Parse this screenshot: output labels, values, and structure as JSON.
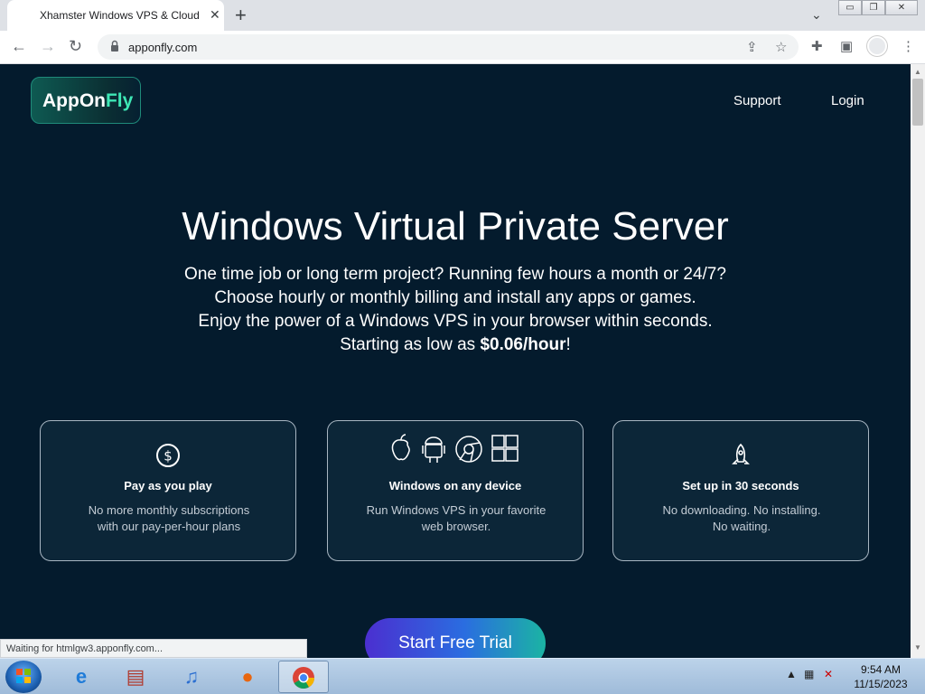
{
  "browser": {
    "tab_title": "Xhamster Windows VPS & Cloud",
    "tab_close": "✕",
    "new_tab": "+",
    "tab_list": "⌄",
    "url": "apponfly.com",
    "status": "Waiting for htmlgw3.apponfly.com..."
  },
  "window_controls": {
    "minimize": "▭",
    "restore": "❐",
    "close": "✕"
  },
  "page": {
    "logo_main": "AppOn",
    "logo_accent": "Fly",
    "nav": {
      "support": "Support",
      "login": "Login"
    },
    "headline": "Windows Virtual Private Server",
    "sub_lines": [
      "One time job or long term project? Running few hours a month or 24/7?",
      "Choose hourly or monthly billing and install any apps or games.",
      "Enjoy the power of a Windows VPS in your browser within seconds."
    ],
    "price_prefix": "Starting as low as ",
    "price": "$0.06/hour",
    "price_suffix": "!",
    "cards": [
      {
        "icon": "dollar-circle-icon",
        "title": "Pay as you play",
        "desc_1": "No more monthly subscriptions",
        "desc_2": "with our pay-per-hour plans"
      },
      {
        "icon": "platform-icons",
        "title": "Windows on any device",
        "desc_1": "Run Windows VPS in your favorite",
        "desc_2": "web browser."
      },
      {
        "icon": "rocket-icon",
        "title": "Set up in 30 seconds",
        "desc_1": "No downloading. No installing.",
        "desc_2": "No waiting."
      }
    ],
    "cta": "Start Free Trial"
  },
  "taskbar": {
    "time": "9:54 AM",
    "date": "11/15/2023"
  },
  "colors": {
    "page_bg": "#041b2d",
    "accent": "#3ee7b5",
    "cta_start": "#4b2fd0",
    "cta_end": "#1bb4a3"
  }
}
